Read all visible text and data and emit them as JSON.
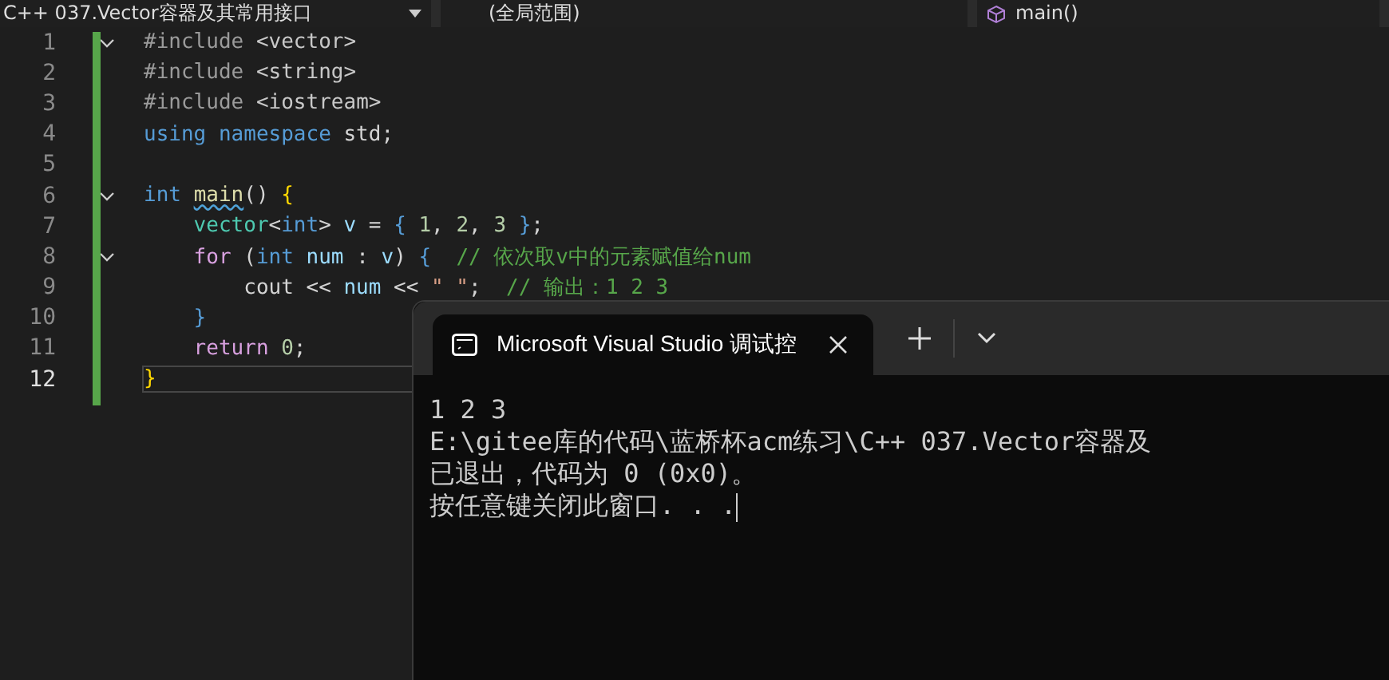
{
  "nav_bar": {
    "file_scope": "C++ 037.Vector容器及其常用接口",
    "scope": "(全局范围)",
    "member": "main()"
  },
  "editor": {
    "lines": [
      {
        "number": "1",
        "fold": true,
        "current": false,
        "tokens": [
          {
            "kind": "preproc",
            "text": "#include "
          },
          {
            "kind": "header",
            "text": "<vector>"
          }
        ]
      },
      {
        "number": "2",
        "fold": false,
        "current": false,
        "tokens": [
          {
            "kind": "preproc",
            "text": "#include "
          },
          {
            "kind": "header",
            "text": "<string>"
          }
        ]
      },
      {
        "number": "3",
        "fold": false,
        "current": false,
        "tokens": [
          {
            "kind": "preproc",
            "text": "#include "
          },
          {
            "kind": "header",
            "text": "<iostream>"
          }
        ]
      },
      {
        "number": "4",
        "fold": false,
        "current": false,
        "tokens": [
          {
            "kind": "keyword",
            "text": "using namespace "
          },
          {
            "kind": "plain",
            "text": "std;"
          }
        ]
      },
      {
        "number": "5",
        "fold": false,
        "current": false
      },
      {
        "number": "6",
        "fold": true,
        "current": false,
        "tokens": [
          {
            "kind": "keyword",
            "text": "int "
          },
          {
            "kind": "func",
            "text": "main"
          },
          {
            "kind": "plain",
            "text": "() "
          },
          {
            "kind": "brace",
            "text": "{"
          }
        ]
      },
      {
        "number": "7",
        "fold": false,
        "current": false,
        "tokens": [
          {
            "kind": "type",
            "text": "    vector"
          },
          {
            "kind": "plain",
            "text": "<"
          },
          {
            "kind": "keyword",
            "text": "int"
          },
          {
            "kind": "plain",
            "text": "> "
          },
          {
            "kind": "ident",
            "text": "v"
          },
          {
            "kind": "plain",
            "text": " = "
          },
          {
            "kind": "brace2",
            "text": "{ "
          },
          {
            "kind": "number",
            "text": "1"
          },
          {
            "kind": "plain",
            "text": ", "
          },
          {
            "kind": "number",
            "text": "2"
          },
          {
            "kind": "plain",
            "text": ", "
          },
          {
            "kind": "number",
            "text": "3"
          },
          {
            "kind": "brace2",
            "text": " }"
          },
          {
            "kind": "plain",
            "text": ";"
          }
        ]
      },
      {
        "number": "8",
        "fold": true,
        "current": false,
        "tokens": [
          {
            "kind": "control",
            "text": "    for"
          },
          {
            "kind": "plain",
            "text": " ("
          },
          {
            "kind": "keyword",
            "text": "int "
          },
          {
            "kind": "ident",
            "text": "num"
          },
          {
            "kind": "plain",
            "text": " : "
          },
          {
            "kind": "ident",
            "text": "v"
          },
          {
            "kind": "plain",
            "text": ") "
          },
          {
            "kind": "brace2",
            "text": "{  "
          },
          {
            "kind": "comment",
            "text": "// 依次取v中的元素赋值给num"
          }
        ]
      },
      {
        "number": "9",
        "fold": false,
        "current": false,
        "tokens": [
          {
            "kind": "plain",
            "text": "        cout << "
          },
          {
            "kind": "ident",
            "text": "num"
          },
          {
            "kind": "plain",
            "text": " << "
          },
          {
            "kind": "string",
            "text": "\" \""
          },
          {
            "kind": "plain",
            "text": ";  "
          },
          {
            "kind": "comment",
            "text": "// 输出：1 2 3"
          }
        ]
      },
      {
        "number": "10",
        "fold": false,
        "current": false,
        "tokens": [
          {
            "kind": "brace2",
            "text": "    }"
          }
        ]
      },
      {
        "number": "11",
        "fold": false,
        "current": false,
        "tokens": [
          {
            "kind": "control",
            "text": "    return "
          },
          {
            "kind": "number",
            "text": "0"
          },
          {
            "kind": "plain",
            "text": ";"
          }
        ]
      },
      {
        "number": "12",
        "fold": false,
        "current": true,
        "tokens": [
          {
            "kind": "brace",
            "text": "}"
          }
        ]
      }
    ]
  },
  "terminal": {
    "tab": {
      "title": "Microsoft Visual Studio 调试控",
      "selected": true
    },
    "output": [
      "1 2 3",
      "E:\\gitee库的代码\\蓝桥杯acm练习\\C++ 037.Vector容器及",
      "已退出，代码为 0 (0x0)。",
      "按任意键关闭此窗口. . ."
    ]
  }
}
